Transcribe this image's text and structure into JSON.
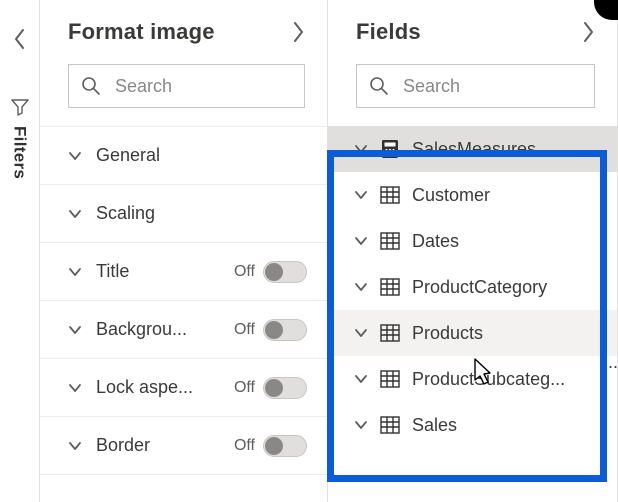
{
  "filters_rail": {
    "label": "Filters"
  },
  "format_pane": {
    "title": "Format image",
    "search": {
      "placeholder": "Search"
    },
    "sections": [
      {
        "label": "General",
        "has_toggle": false
      },
      {
        "label": "Scaling",
        "has_toggle": false
      },
      {
        "label": "Title",
        "has_toggle": true,
        "toggle_text": "Off"
      },
      {
        "label": "Backgrou...",
        "has_toggle": true,
        "toggle_text": "Off"
      },
      {
        "label": "Lock aspe...",
        "has_toggle": true,
        "toggle_text": "Off"
      },
      {
        "label": "Border",
        "has_toggle": true,
        "toggle_text": "Off"
      }
    ]
  },
  "fields_pane": {
    "title": "Fields",
    "search": {
      "placeholder": "Search"
    },
    "tables": [
      {
        "label": "SalesMeasures",
        "icon": "measure",
        "state": "selected"
      },
      {
        "label": "Customer",
        "icon": "table",
        "state": ""
      },
      {
        "label": "Dates",
        "icon": "table",
        "state": ""
      },
      {
        "label": "ProductCategory",
        "icon": "table",
        "state": ""
      },
      {
        "label": "Products",
        "icon": "table",
        "state": "hovered"
      },
      {
        "label": "ProductSubcateg...",
        "icon": "table",
        "state": ""
      },
      {
        "label": "Sales",
        "icon": "table",
        "state": ""
      }
    ]
  }
}
